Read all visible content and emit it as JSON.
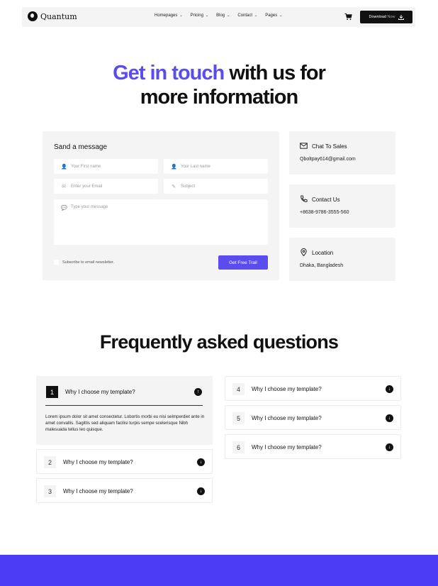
{
  "nav": {
    "logo_text": "Quantum",
    "menu": [
      {
        "label": "Homepages"
      },
      {
        "label": "Pricing"
      },
      {
        "label": "Blog"
      },
      {
        "label": "Contact"
      },
      {
        "label": "Pages"
      }
    ],
    "download_label": "Download",
    "download_suffix": "Now"
  },
  "hero": {
    "accent": "Get in touch",
    "rest": "with us for",
    "line2": "more information"
  },
  "form": {
    "title": "Sand a message",
    "first_name_placeholder": "Your First name",
    "last_name_placeholder": "Your Last name",
    "email_placeholder": "Enter your Email",
    "subject_placeholder": "Subject",
    "message_placeholder": "Type your message",
    "newsletter_label": "Subscribe to email newsletter.",
    "submit_label": "Get Free Trail"
  },
  "contact_cards": [
    {
      "title": "Chat To Sales",
      "value": "Qboltpay614@gmail.com",
      "icon": "mail-icon"
    },
    {
      "title": "Contact Us",
      "value": "+8638-9786-3555-560",
      "icon": "phone-icon"
    },
    {
      "title": "Location",
      "value": "Dhaka, Bangladesh",
      "icon": "location-pin-icon"
    }
  ],
  "faq": {
    "title": "Frequently asked questions",
    "items": [
      {
        "num": "1",
        "question": "Why I choose my template?",
        "answer": "Lorem ipsum dolor sit amet consectetur. Lobortis morbi eu nisi selmperdiet ante in amet convallis. Sagittis sed aliquam facilisi turpis sempe scelerisque Nibh malesuada tellus leo quisque."
      },
      {
        "num": "2",
        "question": "Why I choose my template?"
      },
      {
        "num": "3",
        "question": "Why I choose my template?"
      },
      {
        "num": "4",
        "question": "Why I choose my template?"
      },
      {
        "num": "5",
        "question": "Why I choose my template?"
      },
      {
        "num": "6",
        "question": "Why I choose my template?"
      }
    ]
  },
  "colors": {
    "accent": "#5b4cf0",
    "footer": "#4b3cf5",
    "card_bg": "#f4f4f4"
  }
}
